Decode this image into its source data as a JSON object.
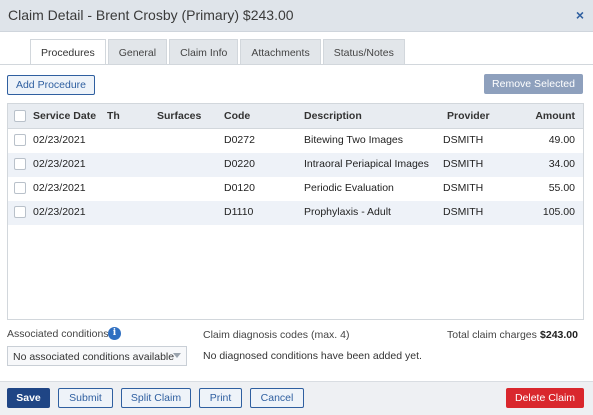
{
  "window": {
    "title": "Claim Detail - Brent Crosby (Primary) $243.00",
    "close_glyph": "×"
  },
  "tabs": [
    {
      "label": "Procedures",
      "active": true
    },
    {
      "label": "General",
      "active": false
    },
    {
      "label": "Claim Info",
      "active": false
    },
    {
      "label": "Attachments",
      "active": false
    },
    {
      "label": "Status/Notes",
      "active": false
    }
  ],
  "toolbar": {
    "add_procedure": "Add Procedure",
    "remove_selected": "Remove Selected"
  },
  "table": {
    "columns": [
      "Service Date",
      "Th",
      "Surfaces",
      "Code",
      "Description",
      "Provider",
      "Amount"
    ],
    "rows": [
      {
        "service_date": "02/23/2021",
        "th": "",
        "surfaces": "",
        "code": "D0272",
        "description": "Bitewing Two Images",
        "provider": "DSMITH",
        "amount": "49.00"
      },
      {
        "service_date": "02/23/2021",
        "th": "",
        "surfaces": "",
        "code": "D0220",
        "description": "Intraoral Periapical Images",
        "provider": "DSMITH",
        "amount": "34.00"
      },
      {
        "service_date": "02/23/2021",
        "th": "",
        "surfaces": "",
        "code": "D0120",
        "description": "Periodic Evaluation",
        "provider": "DSMITH",
        "amount": "55.00"
      },
      {
        "service_date": "02/23/2021",
        "th": "",
        "surfaces": "",
        "code": "D1110",
        "description": "Prophylaxis - Adult",
        "provider": "DSMITH",
        "amount": "105.00"
      }
    ]
  },
  "conditions": {
    "associated_label": "Associated conditions",
    "info_glyph": "i",
    "select_value": "No associated conditions available",
    "diagnosis_label": "Claim diagnosis codes (max. 4)",
    "diagnosis_empty": "No diagnosed conditions have been added yet.",
    "total_label": "Total claim charges",
    "total_value": "$243.00"
  },
  "footer": {
    "save": "Save",
    "submit": "Submit",
    "split_claim": "Split Claim",
    "print": "Print",
    "cancel": "Cancel",
    "delete_claim": "Delete Claim"
  }
}
